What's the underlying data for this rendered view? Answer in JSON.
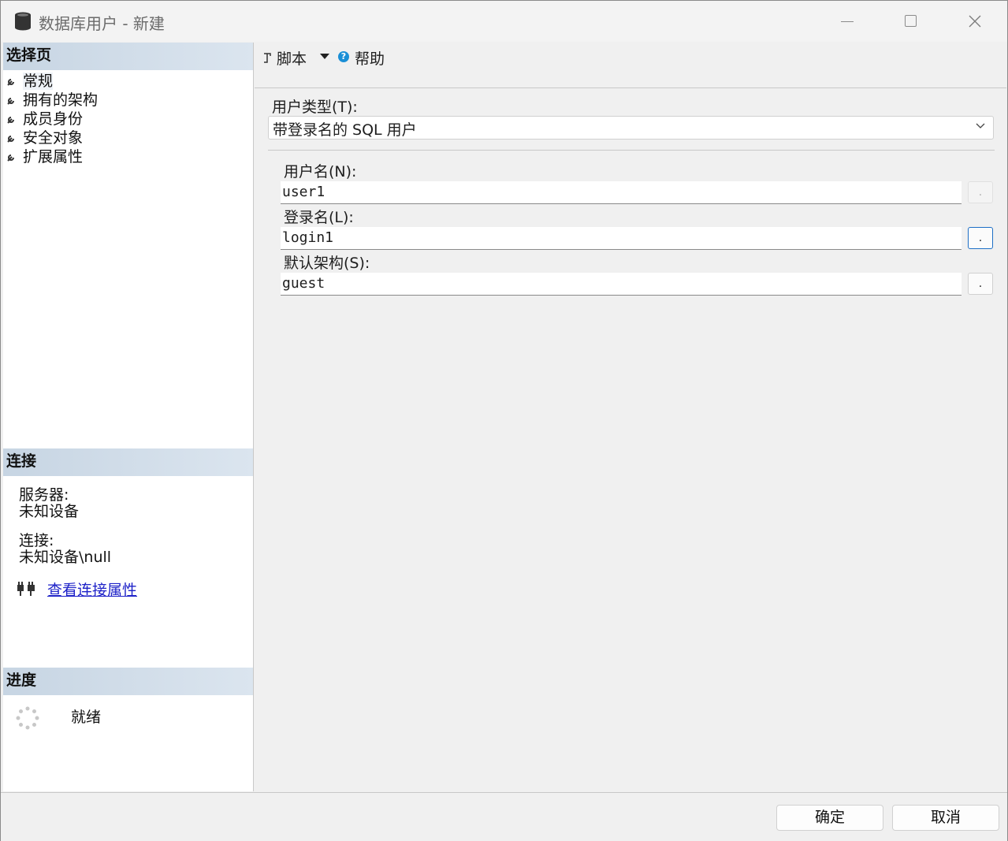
{
  "window": {
    "title": "数据库用户 - 新建"
  },
  "left": {
    "select_page_header": "选择页",
    "pages": [
      {
        "label": "常规",
        "selected": true
      },
      {
        "label": "拥有的架构"
      },
      {
        "label": "成员身份"
      },
      {
        "label": "安全对象"
      },
      {
        "label": "扩展属性"
      }
    ],
    "connection_header": "连接",
    "server_label": "服务器:",
    "server_value": "未知设备",
    "connection_label": "连接:",
    "connection_value": "未知设备\\null",
    "view_connection_link": "查看连接属性",
    "progress_header": "进度",
    "progress_status": "就绪"
  },
  "toolbar": {
    "script_label": "脚本",
    "help_label": "帮助"
  },
  "form": {
    "user_type_label": "用户类型(T):",
    "user_type_value": "带登录名的 SQL 用户",
    "username_label": "用户名(N):",
    "username_value": "user1",
    "login_label": "登录名(L):",
    "login_value": "login1",
    "schema_label": "默认架构(S):",
    "schema_value": "guest",
    "browse_label": "."
  },
  "buttons": {
    "ok": "确定",
    "cancel": "取消"
  }
}
